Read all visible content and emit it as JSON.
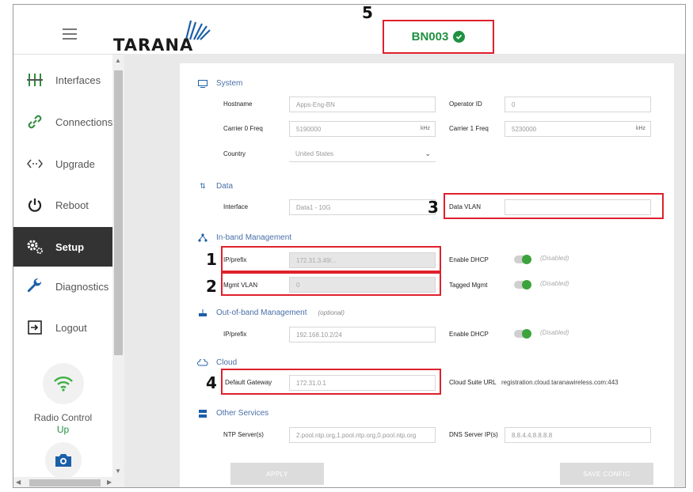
{
  "header": {
    "logo_text": "TARANA",
    "node_name": "BN003",
    "callout": "5"
  },
  "sidebar": {
    "items": [
      {
        "label": "Interfaces"
      },
      {
        "label": "Connections"
      },
      {
        "label": "Upgrade"
      },
      {
        "label": "Reboot"
      },
      {
        "label": "Setup"
      },
      {
        "label": "Diagnostics"
      },
      {
        "label": "Logout"
      }
    ],
    "radio_control_label": "Radio Control",
    "radio_control_status": "Up"
  },
  "system": {
    "title": "System",
    "hostname_label": "Hostname",
    "hostname_value": "Apps-Eng-BN",
    "operator_label": "Operator ID",
    "operator_value": "0",
    "carrier0_label": "Carrier 0 Freq",
    "carrier0_value": "5190000",
    "carrier1_label": "Carrier 1 Freq",
    "carrier1_value": "5230000",
    "freq_unit": "kHz",
    "country_label": "Country",
    "country_value": "United States"
  },
  "data": {
    "title": "Data",
    "interface_label": "Interface",
    "interface_value": "Data1 - 10G",
    "vlan_label": "Data VLAN",
    "vlan_value": "",
    "callout": "3"
  },
  "inband": {
    "title": "In-band Management",
    "ip_label": "IP/prefix",
    "ip_value": "172.31.3.49/...",
    "dhcp_label": "Enable DHCP",
    "dhcp_state": "(Disabled)",
    "vlan_label": "Mgmt VLAN",
    "vlan_value": "0",
    "tagged_label": "Tagged Mgmt",
    "tagged_state": "(Disabled)",
    "callout_ip": "1",
    "callout_vlan": "2"
  },
  "outband": {
    "title": "Out-of-band Management",
    "optional": "(optional)",
    "ip_label": "IP/prefix",
    "ip_value": "192.168.10.2/24",
    "dhcp_label": "Enable DHCP",
    "dhcp_state": "(Disabled)"
  },
  "cloud": {
    "title": "Cloud",
    "gateway_label": "Default Gateway",
    "gateway_value": "172.31.0.1",
    "suite_label": "Cloud Suite URL",
    "suite_value": "registration.cloud.taranawireless.com:443",
    "callout": "4"
  },
  "other": {
    "title": "Other Services",
    "ntp_label": "NTP Server(s)",
    "ntp_value": "2.pool.ntp.org,1.pool.ntp.org,0.pool.ntp.org",
    "dns_label": "DNS Server IP(s)",
    "dns_value": "8.8.4.4,8.8.8.8"
  },
  "buttons": {
    "apply": "APPLY",
    "save_config": "SAVE CONFIG"
  },
  "colors": {
    "accent_red": "#e0202c",
    "status_green": "#1f9141",
    "section_blue": "#4a6ea8"
  }
}
